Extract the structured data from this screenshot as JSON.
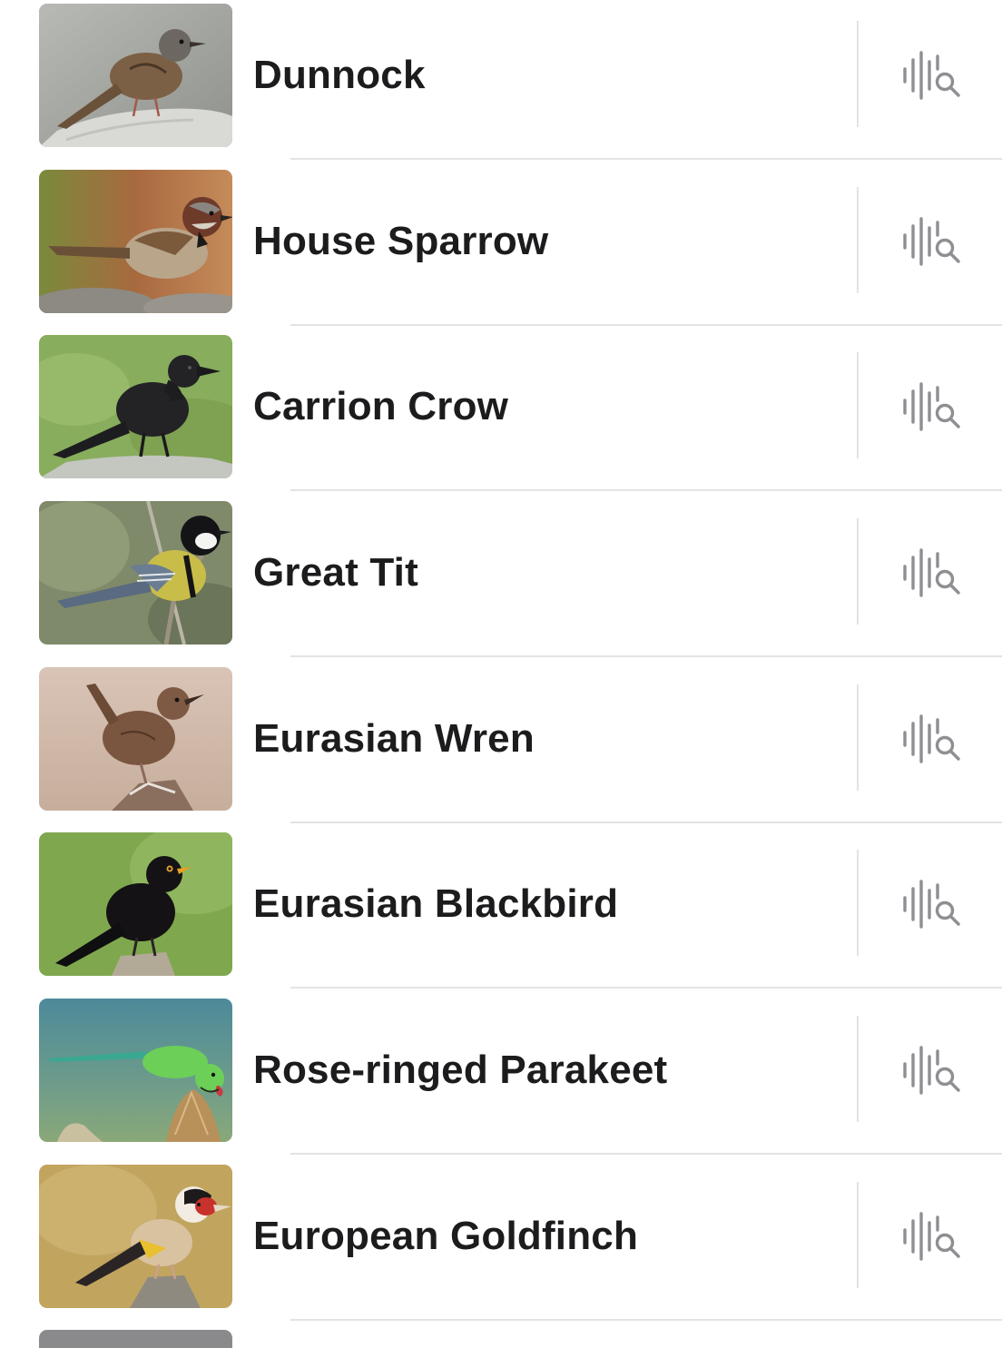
{
  "birds": [
    {
      "name": "Dunnock",
      "thumb_icon": "dunnock-photo",
      "action_icon": "sound-search-icon"
    },
    {
      "name": "House Sparrow",
      "thumb_icon": "house-sparrow-photo",
      "action_icon": "sound-search-icon"
    },
    {
      "name": "Carrion Crow",
      "thumb_icon": "carrion-crow-photo",
      "action_icon": "sound-search-icon"
    },
    {
      "name": "Great Tit",
      "thumb_icon": "great-tit-photo",
      "action_icon": "sound-search-icon"
    },
    {
      "name": "Eurasian Wren",
      "thumb_icon": "eurasian-wren-photo",
      "action_icon": "sound-search-icon"
    },
    {
      "name": "Eurasian Blackbird",
      "thumb_icon": "eurasian-blackbird-photo",
      "action_icon": "sound-search-icon"
    },
    {
      "name": "Rose-ringed Parakeet",
      "thumb_icon": "rose-ringed-parakeet-photo",
      "action_icon": "sound-search-icon"
    },
    {
      "name": "European Goldfinch",
      "thumb_icon": "european-goldfinch-photo",
      "action_icon": "sound-search-icon"
    }
  ],
  "colors": {
    "text": "#1c1c1e",
    "icon": "#8e8e93",
    "separator": "#e3e3e6",
    "background": "#ffffff"
  }
}
